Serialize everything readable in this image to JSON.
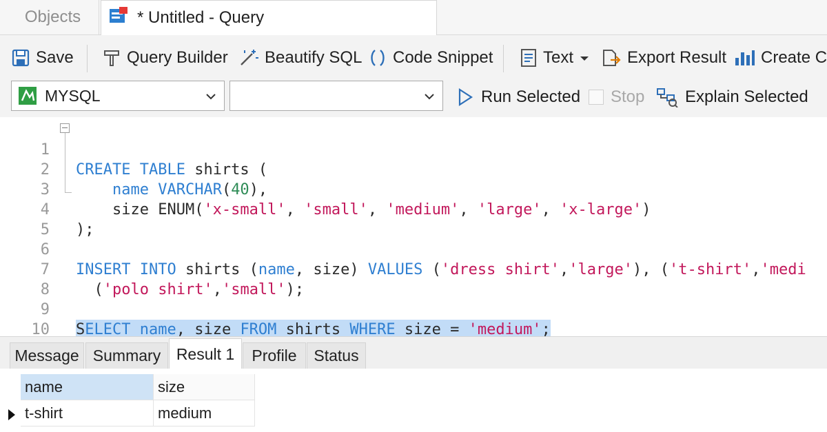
{
  "tabs": {
    "objects_label": "Objects",
    "query_label": "* Untitled - Query"
  },
  "toolbar": {
    "save_label": "Save",
    "query_builder_label": "Query Builder",
    "beautify_label": "Beautify SQL",
    "snippet_label": "Code Snippet",
    "text_label": "Text",
    "export_label": "Export Result",
    "create_chart_label": "Create Ch"
  },
  "connection": {
    "db_type": "MYSQL",
    "database": "",
    "run_selected_label": "Run Selected",
    "stop_label": "Stop",
    "explain_label": "Explain Selected"
  },
  "editor": {
    "line_numbers": [
      "1",
      "2",
      "3",
      "4",
      "5",
      "6",
      "7",
      "8",
      "9",
      "10"
    ],
    "line1": {
      "kw1": "CREATE TABLE",
      "rest": " shirts ("
    },
    "line2": {
      "indent": "    ",
      "kw1": "name",
      "sp": " ",
      "kw2": "VARCHAR",
      "p1": "(",
      "num": "40",
      "p2": "),"
    },
    "line3": {
      "indent": "    ",
      "pre": "size ENUM(",
      "s1": "'x-small'",
      "c1": ", ",
      "s2": "'small'",
      "c2": ", ",
      "s3": "'medium'",
      "c3": ", ",
      "s4": "'large'",
      "c4": ", ",
      "s5": "'x-large'",
      "end": ")"
    },
    "line4": {
      "text": ");"
    },
    "line6": {
      "kw1": "INSERT INTO",
      "mid1": " shirts (",
      "kw2": "name",
      "mid2": ", size) ",
      "kw3": "VALUES",
      "mid3": " (",
      "s1": "'dress shirt'",
      "c1": ",",
      "s2": "'large'",
      "mid4": "), (",
      "s3": "'t-shirt'",
      "c2": ",",
      "s4": "'medi"
    },
    "line7": {
      "indent": "  ",
      "p1": "(",
      "s1": "'polo shirt'",
      "c1": ",",
      "s2": "'small'",
      "end": ");"
    },
    "line9": {
      "first": "S",
      "kw0": "ELECT",
      "sp1": " ",
      "kw1": "name",
      "t1": ", size ",
      "kw2": "FROM",
      "t2": " shirts ",
      "kw3": "WHERE",
      "t3": " size = ",
      "s1": "'medium'",
      "end": ";"
    }
  },
  "result_tabs": [
    "Message",
    "Summary",
    "Result 1",
    "Profile",
    "Status"
  ],
  "result_active_tab": "Result 1",
  "grid": {
    "columns": [
      "name",
      "size"
    ],
    "rows": [
      [
        "t-shirt",
        "medium"
      ]
    ]
  },
  "colors": {
    "keyword": "#2f7fd1",
    "string": "#c2185b",
    "number": "#2f8c57",
    "selection": "#c2dcf7"
  },
  "icons": [
    "query-tab-icon",
    "save-icon",
    "query-builder-icon",
    "beautify-icon",
    "code-snippet-icon",
    "text-icon",
    "export-icon",
    "chart-icon",
    "mysql-icon",
    "run-icon",
    "explain-icon",
    "chevron-down-icon",
    "row-pointer-icon"
  ]
}
